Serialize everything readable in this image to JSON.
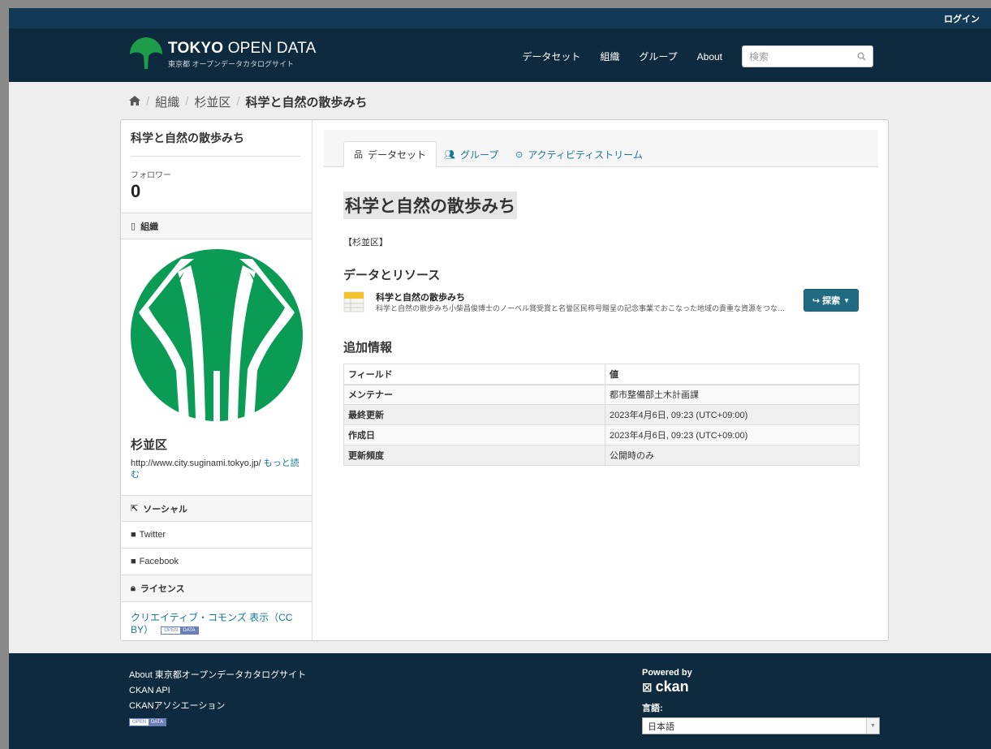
{
  "header": {
    "login": "ログイン",
    "logo_title_bold": "TOKYO",
    "logo_title_rest": " OPEN DATA",
    "logo_sub": "東京都 オープンデータカタログサイト",
    "nav": [
      "データセット",
      "組織",
      "グループ",
      "About"
    ],
    "search_placeholder": "検索"
  },
  "breadcrumb": {
    "items": [
      "組織",
      "杉並区"
    ],
    "current": "科学と自然の散歩みち"
  },
  "sidebar": {
    "title": "科学と自然の散歩みち",
    "followers_label": "フォロワー",
    "followers_count": "0",
    "org_heading": "組織",
    "org_name": "杉並区",
    "org_url": "http://www.city.suginami.tokyo.jp/",
    "read_more": "もっと読む",
    "social_heading": "ソーシャル",
    "social": [
      "Twitter",
      "Facebook"
    ],
    "license_heading": "ライセンス",
    "license_text": "クリエイティブ・コモンズ 表示（CC BY）",
    "badge_left": "OPEN",
    "badge_right": "DATA"
  },
  "tabs": [
    "データセット",
    "グループ",
    "アクティビティストリーム"
  ],
  "dataset": {
    "title": "科学と自然の散歩みち",
    "notes": "【杉並区】",
    "resources_heading": "データとリソース",
    "resource": {
      "format": "CSV",
      "name": "科学と自然の散歩みち",
      "description": "科学と自然の散歩みち小柴昌俊博士のノーベル賞受賞と名誉区民称号贈呈の記念事業でおこなった地域の貴重な資源をつな…",
      "explore": "探索"
    },
    "additional_heading": "追加情報",
    "table_headers": [
      "フィールド",
      "値"
    ],
    "rows": [
      [
        "メンテナー",
        "都市整備部土木計画課"
      ],
      [
        "最終更新",
        "2023年4月6日, 09:23 (UTC+09:00)"
      ],
      [
        "作成日",
        "2023年4月6日, 09:23 (UTC+09:00)"
      ],
      [
        "更新頻度",
        "公開時のみ"
      ]
    ]
  },
  "footer": {
    "links": [
      "About 東京都オープンデータカタログサイト",
      "CKAN API",
      "CKANアソシエーション"
    ],
    "powered_by": "Powered by",
    "ckan": "ckan",
    "language_label": "言語:",
    "language_value": "日本語"
  },
  "colors": {
    "navy": "#0e2a3e",
    "link": "#187794",
    "button": "#206b82",
    "logo_green": "#1e9c4a",
    "ward_green": "#0a9b55"
  }
}
